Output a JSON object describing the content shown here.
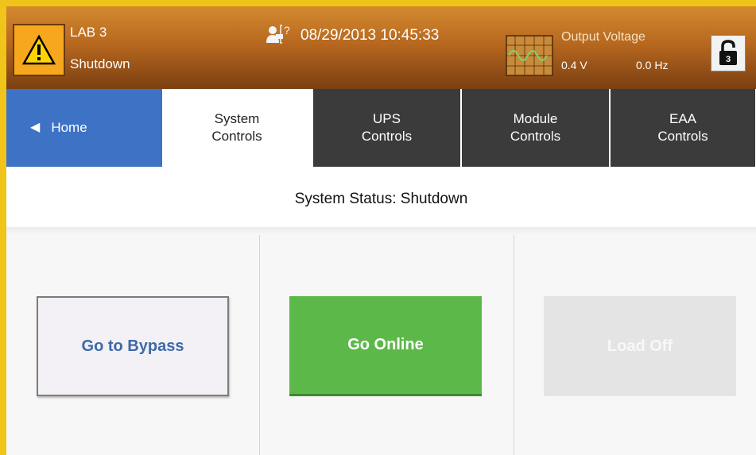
{
  "header": {
    "lab_name": "LAB 3",
    "lab_status": "Shutdown",
    "datetime": "08/29/2013 10:45:33",
    "output_label": "Output Voltage",
    "output_voltage": "0.4 V",
    "output_frequency": "0.0 Hz",
    "lock_number": "3",
    "help_symbol": "?"
  },
  "tabs": [
    {
      "label": "Home"
    },
    {
      "label": "System\nControls"
    },
    {
      "label": "UPS\nControls"
    },
    {
      "label": "Module\nControls"
    },
    {
      "label": "EAA\nControls"
    }
  ],
  "status": {
    "text": "System Status: Shutdown"
  },
  "actions": {
    "bypass_label": "Go to Bypass",
    "online_label": "Go Online",
    "loadoff_label": "Load Off"
  },
  "colors": {
    "header_top": "#d38a2f",
    "header_bottom": "#7a3f12",
    "home_tab": "#3d72c4",
    "dark_tab": "#3b3b3b",
    "online_green": "#5cb848",
    "frame_yellow": "#f0c419"
  },
  "icons": {
    "alarm": "warning-triangle-icon",
    "help": "help-person-icon",
    "waveform": "sine-wave-icon",
    "lock": "unlock-icon",
    "back": "left-arrow-icon"
  }
}
